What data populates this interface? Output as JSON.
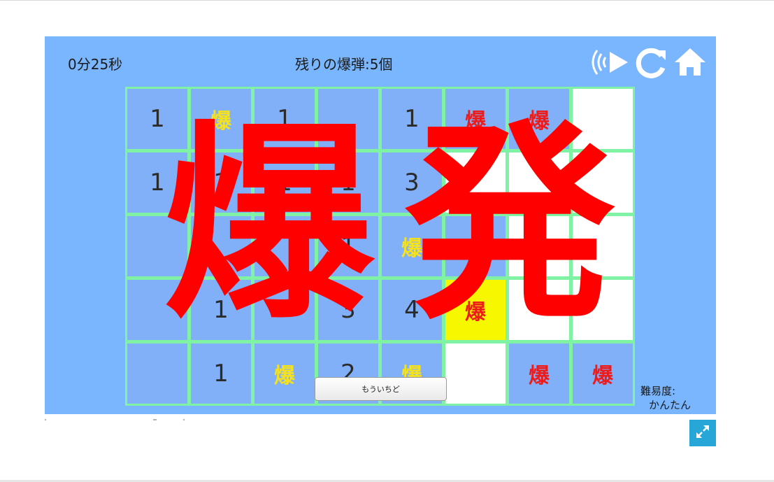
{
  "header": {
    "timer": "0分25秒",
    "remaining": "残りの爆弾:5個"
  },
  "toolbar": {
    "sound_icon": "sound-on-icon",
    "restart_icon": "restart-icon",
    "home_icon": "home-icon"
  },
  "board": {
    "rows": 5,
    "cols": 8,
    "cells": [
      [
        "1",
        "爆",
        "1",
        "",
        "1",
        "爆",
        "爆",
        ""
      ],
      [
        "1",
        "1",
        "1",
        "1",
        "3",
        "",
        "",
        ""
      ],
      [
        "",
        "",
        "",
        "1",
        "爆",
        "",
        "",
        ""
      ],
      [
        "",
        "1",
        "",
        "3",
        "4",
        "爆",
        "",
        ""
      ],
      [
        "",
        "1",
        "爆",
        "2",
        "爆",
        "",
        "爆",
        "爆"
      ]
    ],
    "cell_states": [
      [
        "closed",
        "bomb-yellow",
        "closed",
        "closed",
        "closed",
        "bomb-red",
        "bomb-red",
        "open"
      ],
      [
        "closed",
        "closed",
        "closed",
        "closed",
        "closed",
        "open",
        "open",
        "open"
      ],
      [
        "closed",
        "closed",
        "closed",
        "closed",
        "bomb-yellow",
        "closed",
        "open",
        "open"
      ],
      [
        "closed",
        "closed",
        "closed",
        "closed",
        "closed",
        "hit",
        "open",
        "open"
      ],
      [
        "closed",
        "closed",
        "bomb-yellow",
        "closed",
        "bomb-yellow",
        "open",
        "bomb-red",
        "bomb-red"
      ]
    ]
  },
  "overlay": {
    "explosion_text_1": "爆",
    "explosion_text_2": "発"
  },
  "retry_button": "もういちど",
  "difficulty": {
    "label": "難易度:",
    "value": "かんたん"
  },
  "colors": {
    "background": "#7ab6fd",
    "cell": "#82b0f8",
    "cell_border": "#7ff2a4",
    "explosion": "#ff0000",
    "hit_cell": "#f7f700",
    "fullscreen_button": "#27a6d8"
  },
  "fullscreen_icon": "expand-icon"
}
